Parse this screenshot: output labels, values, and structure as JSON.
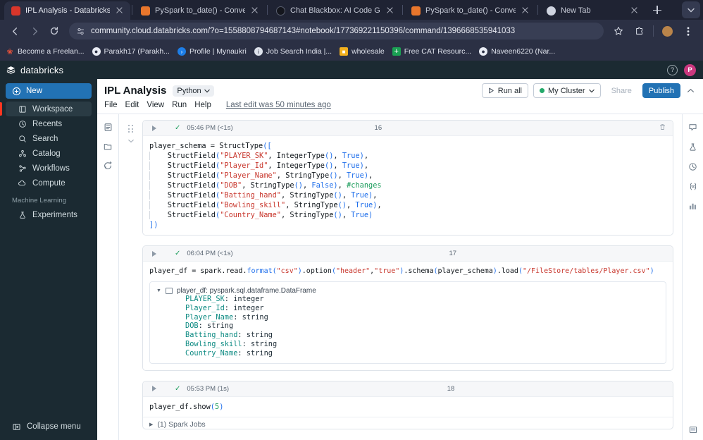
{
  "browser": {
    "tabs": [
      {
        "title": "IPL Analysis - Databricks Con",
        "active": true,
        "favicon": "databricks-red-icon"
      },
      {
        "title": "PySpark to_date() - Convert S",
        "active": false,
        "favicon": "spark-orange-icon"
      },
      {
        "title": "Chat Blackbox: AI Code Gene",
        "active": false,
        "favicon": "blackbox-dark-icon"
      },
      {
        "title": "PySpark to_date() - Convert S",
        "active": false,
        "favicon": "spark-orange-icon"
      },
      {
        "title": "New Tab",
        "active": false,
        "favicon": "chrome-icon"
      }
    ],
    "new_tab_label": "+",
    "tabstrip_menu_icon": "chevron-down-icon",
    "nav": {
      "back_icon": "arrow-left-icon",
      "forward_icon": "arrow-right-icon",
      "reload_icon": "reload-icon"
    },
    "omnibox": {
      "site_settings_icon": "tune-icon",
      "url": "community.cloud.databricks.com/?o=1558808794687143#notebook/177369221150396/command/1396668535941033",
      "bookmark_icon": "star-icon",
      "extensions_icon": "puzzle-icon",
      "profile_icon": "avatar-icon",
      "menu_icon": "kebab-menu-icon"
    },
    "bookmarks": [
      {
        "label": "Become a Freelan...",
        "icon": "freelancer-icon",
        "color": "#e8513a"
      },
      {
        "label": "Parakh17 (Parakh...",
        "icon": "github-icon",
        "color": "#e9ecf4"
      },
      {
        "label": "Profile | Mynaukri",
        "icon": "mynaukri-icon",
        "color": "#1d7ee8"
      },
      {
        "label": "Job Search India |...",
        "icon": "info-icon",
        "color": "#dfe3ec"
      },
      {
        "label": "wholesale",
        "icon": "wholesale-icon",
        "color": "#f2b01e"
      },
      {
        "label": "Free CAT Resourc...",
        "icon": "plus-green-icon",
        "color": "#1aa053"
      },
      {
        "label": "Naveen6220 (Nar...",
        "icon": "github-icon",
        "color": "#e9ecf4"
      }
    ]
  },
  "db_header": {
    "logo_text": "databricks",
    "logo_icon": "databricks-logo-icon",
    "help_icon": "help-circle-icon",
    "avatar_initial": "P"
  },
  "sidebar": {
    "new_button": {
      "label": "New",
      "icon": "plus-circle-icon"
    },
    "items": [
      {
        "label": "Workspace",
        "icon": "workspace-icon",
        "selected": true
      },
      {
        "label": "Recents",
        "icon": "clock-icon",
        "selected": false
      },
      {
        "label": "Search",
        "icon": "search-icon",
        "selected": false
      },
      {
        "label": "Catalog",
        "icon": "catalog-icon",
        "selected": false
      },
      {
        "label": "Workflows",
        "icon": "workflows-icon",
        "selected": false
      },
      {
        "label": "Compute",
        "icon": "cloud-icon",
        "selected": false
      }
    ],
    "section_label": "Machine Learning",
    "ml_items": [
      {
        "label": "Experiments",
        "icon": "experiments-icon"
      }
    ],
    "collapse": {
      "label": "Collapse menu",
      "icon": "collapse-panel-icon"
    }
  },
  "notebook": {
    "title": "IPL Analysis",
    "language": "Python",
    "language_caret_icon": "chevron-down-icon",
    "menus": [
      "File",
      "Edit",
      "View",
      "Run",
      "Help"
    ],
    "last_edit": "Last edit was 50 minutes ago",
    "toolbar": {
      "run_all": "Run all",
      "run_all_icon": "play-icon",
      "cluster": "My Cluster",
      "cluster_status_color": "#23a96a",
      "cluster_caret_icon": "chevron-down-icon",
      "share": "Share",
      "publish": "Publish",
      "collapse_icon": "chevron-up-icon"
    },
    "left_rail_icons": [
      "notebook-toc-icon",
      "folder-icon",
      "new-comment-icon"
    ],
    "right_rail_icons": [
      "comment-icon",
      "experiments-icon",
      "history-icon",
      "variables-icon",
      "dashboard-icon"
    ],
    "right_rail_bottom_icon": "layout-panel-icon",
    "cells": [
      {
        "run_icon": "play-icon",
        "status_icon": "check-icon",
        "timestamp": "05:46 PM (<1s)",
        "number": "16",
        "trash_icon": "trash-icon",
        "drag_icon": "drag-handle-icon",
        "collapse_icon": "chevron-down-icon",
        "code_lines": [
          "player_schema = StructType([",
          "    StructField(\"PLAYER_SK\", IntegerType(), True),",
          "    StructField(\"Player_Id\", IntegerType(), True),",
          "    StructField(\"Player_Name\", StringType(), True),",
          "    StructField(\"DOB\", StringType(), False), #changes",
          "    StructField(\"Batting_hand\", StringType(), True),",
          "    StructField(\"Bowling_skill\", StringType(), True),",
          "    StructField(\"Country_Name\", StringType(), True)",
          "])"
        ]
      },
      {
        "run_icon": "play-icon",
        "status_icon": "check-icon",
        "timestamp": "06:04 PM (<1s)",
        "number": "17",
        "code_lines": [
          "player_df = spark.read.format(\"csv\").option(\"header\",\"true\").schema(player_schema).load(\"/FileStore/tables/Player.csv\")"
        ],
        "result": {
          "caret_icon": "caret-down-icon",
          "table_icon": "table-icon",
          "header": "player_df: pyspark.sql.dataframe.DataFrame",
          "fields": [
            {
              "name": "PLAYER_SK",
              "type": "integer"
            },
            {
              "name": "Player_Id",
              "type": "integer"
            },
            {
              "name": "Player_Name",
              "type": "string"
            },
            {
              "name": "DOB",
              "type": "string"
            },
            {
              "name": "Batting_hand",
              "type": "string"
            },
            {
              "name": "Bowling_skill",
              "type": "string"
            },
            {
              "name": "Country_Name",
              "type": "string"
            }
          ]
        }
      },
      {
        "run_icon": "play-icon",
        "status_icon": "check-icon",
        "timestamp": "05:53 PM (1s)",
        "number": "18",
        "code_lines": [
          "player_df.show(5)"
        ],
        "spark_jobs": "(1) Spark Jobs",
        "spark_jobs_caret_icon": "caret-right-icon"
      }
    ]
  }
}
